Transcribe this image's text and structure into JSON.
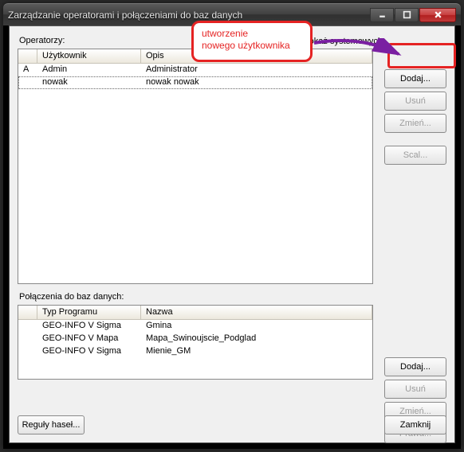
{
  "window": {
    "title": "Zarządzanie operatorami i połączeniami do baz danych"
  },
  "operators": {
    "section_label": "Operatorzy:",
    "show_system_label": "Pokaż systemowych",
    "columns": {
      "a": "",
      "user": "Użytkownik",
      "desc": "Opis"
    },
    "rows": [
      {
        "a": "A",
        "user": "Admin",
        "desc": "Administrator"
      },
      {
        "a": "",
        "user": "nowak",
        "desc": "nowak nowak"
      }
    ],
    "buttons": {
      "add": "Dodaj...",
      "del": "Usuń",
      "edit": "Zmień...",
      "merge": "Scal..."
    }
  },
  "connections": {
    "section_label": "Połączenia do baz danych:",
    "columns": {
      "blank": "",
      "prog": "Typ Programu",
      "name": "Nazwa"
    },
    "rows": [
      {
        "prog": "GEO-INFO V Sigma",
        "name": "Gmina"
      },
      {
        "prog": "GEO-INFO V Mapa",
        "name": "Mapa_Swinoujscie_Podglad"
      },
      {
        "prog": "GEO-INFO V Sigma",
        "name": "Mienie_GM"
      }
    ],
    "buttons": {
      "add": "Dodaj...",
      "del": "Usuń",
      "edit": "Zmień...",
      "rights": "Prawa..."
    }
  },
  "footer": {
    "rules": "Reguły haseł...",
    "close": "Zamknij"
  },
  "annotation": {
    "text1": "utworzenie",
    "text2": "nowego użytkownika"
  }
}
